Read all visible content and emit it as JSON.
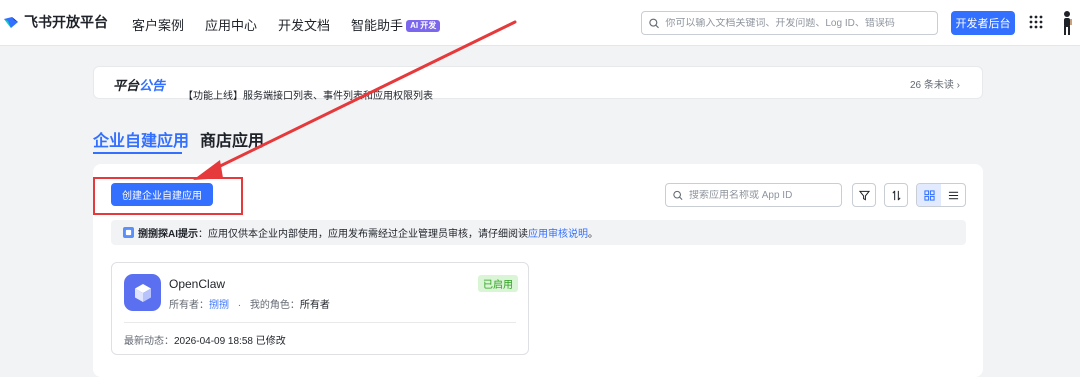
{
  "header": {
    "logo_text": "飞书开放平台",
    "nav": [
      {
        "label": "客户案例"
      },
      {
        "label": "应用中心"
      },
      {
        "label": "开发文档"
      },
      {
        "label": "智能助手",
        "badge": "AI 开发"
      }
    ],
    "search_placeholder": "你可以输入文档关键词、开发问题、Log ID、错误码",
    "dev_button": "开发者后台"
  },
  "announcement": {
    "title_part1": "平台",
    "title_part2": "公告",
    "text": "【功能上线】服务端接口列表、事件列表和应用权限列表",
    "unread": "26 条未读"
  },
  "tabs": [
    {
      "label": "企业自建应用",
      "active": true
    },
    {
      "label": "商店应用",
      "active": false
    }
  ],
  "toolbar": {
    "create_button": "创建企业自建应用",
    "search_placeholder": "搜索应用名称或 App ID"
  },
  "tip": {
    "bold": "捌捌探AI提示",
    "text": "：应用仅供本企业内部使用，应用发布需经过企业管理员审核，请仔细阅读 ",
    "link": "应用审核说明",
    "end": "。"
  },
  "app_card": {
    "name": "OpenClaw",
    "status": "已启用",
    "owner_label": "所有者：",
    "owner_value": "捌捌",
    "separator": "·",
    "role_label": "我的角色：",
    "role_value": "所有者",
    "last_activity_label": "最新动态：",
    "last_activity_value": "2026-04-09 18:58 已修改"
  },
  "colors": {
    "accent": "#3370ff",
    "annotation_red": "#e5393b",
    "app_icon": "#5b70f0",
    "status_green": "#2ea121"
  }
}
